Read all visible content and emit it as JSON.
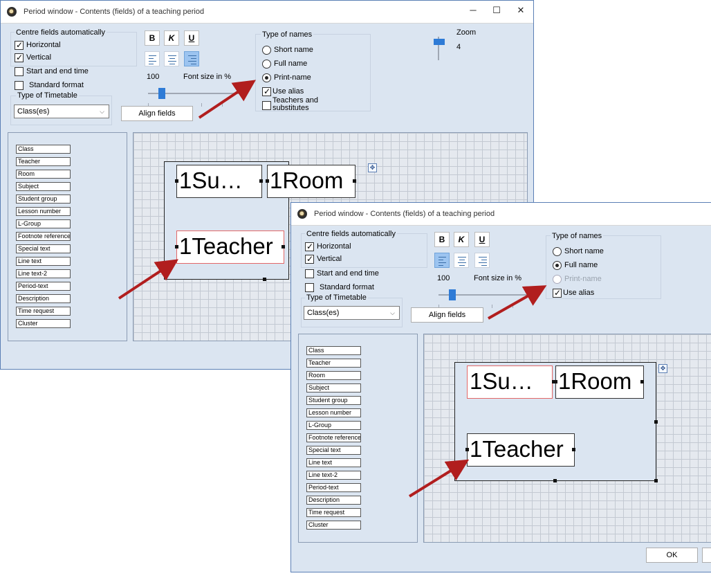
{
  "windows": [
    {
      "title": "Period window - Contents (fields) of a teaching period",
      "title_controls": {
        "minimize": "─",
        "maximize": "☐",
        "close": "✕"
      },
      "centre_group_label": "Centre fields automatically",
      "horizontal_label": "Horizontal",
      "vertical_label": "Vertical",
      "start_end_label": "Start and end time",
      "standard_format_label": "Standard format",
      "timetable_type_label": "Type of Timetable",
      "timetable_type_value": "Class(es)",
      "format_buttons": {
        "bold": "B",
        "italic": "K",
        "underline": "U"
      },
      "font_size_value": "100",
      "font_size_label": "Font size in %",
      "align_fields_label": "Align fields",
      "names_group_label": "Type of names",
      "short_name_label": "Short name",
      "full_name_label": "Full name",
      "print_name_label": "Print-name",
      "use_alias_label": "Use alias",
      "teachers_subs_label": "Teachers and substitutes",
      "selected_name_type": "print-name",
      "zoom_label": "Zoom",
      "zoom_value": "4",
      "fields": [
        "Class",
        "Teacher",
        "Room",
        "Subject",
        "Student group",
        "Lesson number",
        "L-Group",
        "Footnote reference",
        "Special text",
        "Line text",
        "Line text-2",
        "Period-text",
        "Description",
        "Time request",
        "Cluster"
      ],
      "period_fields": {
        "subject": "1Su…",
        "room": "1Room",
        "teacher": "1Teacher"
      }
    },
    {
      "title": "Period window - Contents (fields) of a teaching period",
      "centre_group_label": "Centre fields automatically",
      "horizontal_label": "Horizontal",
      "vertical_label": "Vertical",
      "start_end_label": "Start and end time",
      "standard_format_label": "Standard format",
      "timetable_type_label": "Type of Timetable",
      "timetable_type_value": "Class(es)",
      "format_buttons": {
        "bold": "B",
        "italic": "K",
        "underline": "U"
      },
      "font_size_value": "100",
      "font_size_label": "Font size in %",
      "align_fields_label": "Align fields",
      "names_group_label": "Type of names",
      "short_name_label": "Short name",
      "full_name_label": "Full name",
      "print_name_label": "Print-name",
      "use_alias_label": "Use alias",
      "selected_name_type": "full-name",
      "fields": [
        "Class",
        "Teacher",
        "Room",
        "Subject",
        "Student group",
        "Lesson number",
        "L-Group",
        "Footnote reference",
        "Special text",
        "Line text",
        "Line text-2",
        "Period-text",
        "Description",
        "Time request",
        "Cluster"
      ],
      "period_fields": {
        "subject": "1Su…",
        "room": "1Room",
        "teacher": "1Teacher"
      },
      "ok_label": "OK"
    }
  ],
  "colors": {
    "arrow": "#b11e1e",
    "window_bg": "#dbe5f1",
    "slider_accent": "#2e7bd6",
    "selected_field_border": "#e36767"
  }
}
